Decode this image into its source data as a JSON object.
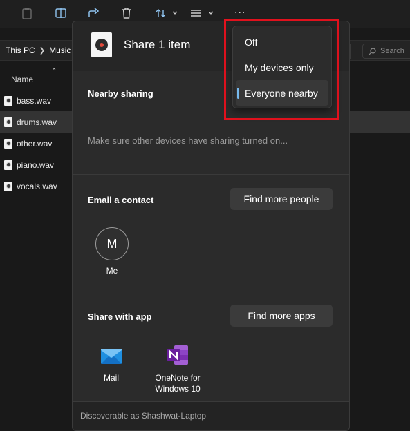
{
  "explorer": {
    "breadcrumb": [
      "This PC",
      "Music"
    ],
    "search_placeholder": "Search",
    "column_name": "Name",
    "column_right": "n",
    "files": [
      {
        "name": "bass.wav",
        "selected": false
      },
      {
        "name": "drums.wav",
        "selected": true
      },
      {
        "name": "other.wav",
        "selected": false
      },
      {
        "name": "piano.wav",
        "selected": false
      },
      {
        "name": "vocals.wav",
        "selected": false
      }
    ],
    "toolbar_icons": [
      "paste-icon",
      "copy-path-icon",
      "share-icon",
      "delete-icon",
      "sort-icon",
      "view-icon",
      "more-icon"
    ],
    "more_glyph": "..."
  },
  "share": {
    "title": "Share 1 item",
    "nearby": {
      "title": "Nearby sharing",
      "hint": "Make sure other devices have sharing turned on...",
      "options": [
        {
          "label": "Off",
          "selected": false
        },
        {
          "label": "My devices only",
          "selected": false
        },
        {
          "label": "Everyone nearby",
          "selected": true
        }
      ]
    },
    "email": {
      "title": "Email a contact",
      "button": "Find more people",
      "contacts": [
        {
          "initial": "M",
          "name": "Me"
        }
      ]
    },
    "apps": {
      "title": "Share with app",
      "button": "Find more apps",
      "list": [
        {
          "name": "Mail",
          "line2": "",
          "icon": "mail-icon"
        },
        {
          "name": "OneNote for",
          "line2": "Windows 10",
          "icon": "onenote-icon"
        }
      ]
    },
    "footer": "Discoverable as Shashwat-Laptop"
  },
  "colors": {
    "highlight": "#e3121e",
    "accent": "#76b9ed",
    "onenote": "#7b2fb0",
    "mail": "#1f8fe0"
  }
}
